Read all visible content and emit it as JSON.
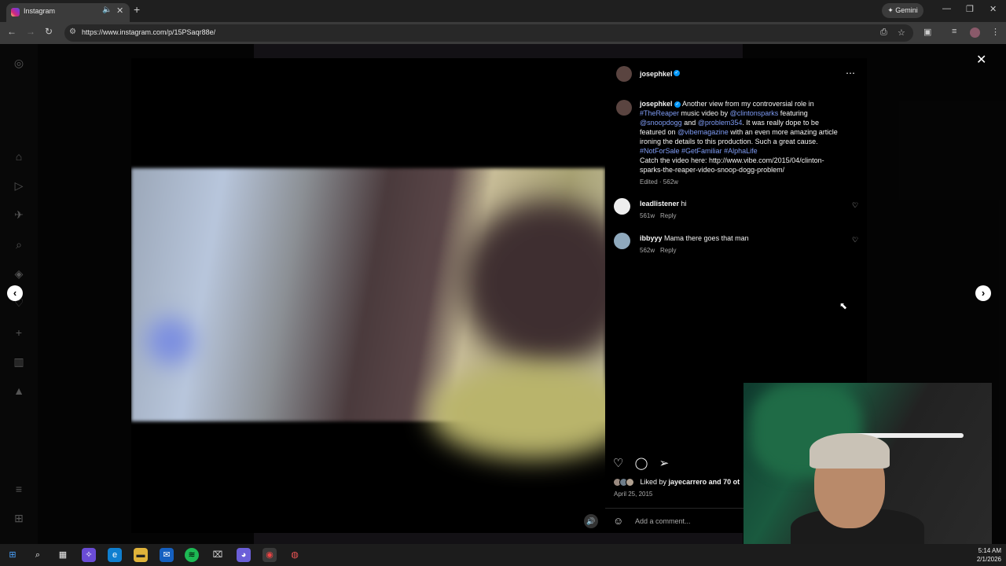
{
  "browser": {
    "tab_title": "Instagram",
    "url": "https://www.instagram.com/p/15PSaqr88e/",
    "gemini_label": "Gemini"
  },
  "post": {
    "author": "josephkel",
    "caption_parts": {
      "t1": "Another view from my controversial role in ",
      "h1": "#TheReaper",
      "t2": " music video by ",
      "m1": "@clintonsparks",
      "t3": " featuring ",
      "m2": "@snoopdogg",
      "t4": " and ",
      "m3": "@problem354",
      "t5": ". It was really dope to be featured on ",
      "m4": "@vibemagazine",
      "t6": " with an even more amazing article ironing the details to this production. Such a great cause. ",
      "h2": "#NotForSale",
      "h3": "#GetFamiliar",
      "h4": "#AlphaLife",
      "t7": "Catch the video here: http://www.vibe.com/2015/04/clinton-sparks-the-reaper-video-snoop-dogg-problem/"
    },
    "caption_meta": "Edited · 562w",
    "comments": [
      {
        "user": "leadlistener",
        "text": "hi",
        "age": "561w",
        "reply": "Reply"
      },
      {
        "user": "ibbyyy",
        "text": "Mama there goes that man",
        "age": "562w",
        "reply": "Reply"
      }
    ],
    "likes_prefix": "Liked by ",
    "likes_user": "jayecarrero",
    "likes_suffix": " and 70 ot",
    "date": "April 25, 2015",
    "comment_placeholder": "Add a comment..."
  },
  "taskbar": {
    "time": "5:14 AM",
    "date": "2/1/2026"
  }
}
